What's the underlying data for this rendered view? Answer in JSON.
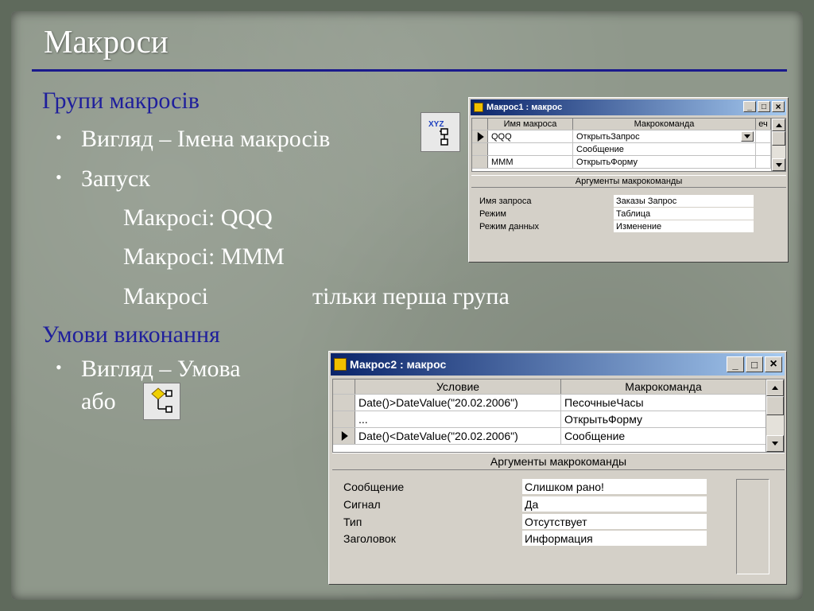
{
  "slide": {
    "title": "Макроси",
    "section1_heading": "Групи макросів",
    "bullet1": "Вигляд – Імена макросів",
    "bullet2": "Запуск",
    "sub1": "Макросі: QQQ",
    "sub2": "Макросі: MMM",
    "sub3_a": "Макросі",
    "sub3_b": "тільки перша група",
    "section2_heading": "Умови виконання",
    "bullet3_line1": "Вигляд – Умова",
    "bullet3_line2": "або"
  },
  "colors": {
    "heading": "#1f1f9c",
    "bullet_text": "#ffffff",
    "title_rule": "#1a1a8c",
    "titlebar_start": "#0a246a",
    "titlebar_end": "#a6caf0"
  },
  "icons": {
    "macro_names_toolbar_icon": "macro-names-icon",
    "conditions_toolbar_icon": "conditions-icon"
  },
  "window1": {
    "title": "Макрос1 : макрос",
    "controls": {
      "minimize": "_",
      "maximize": "□",
      "close": "×"
    },
    "columns": [
      "Имя макроса",
      "Макрокоманда",
      "еч"
    ],
    "rows": [
      {
        "name": "QQQ",
        "action": "ОткрытьЗапрос",
        "current": true
      },
      {
        "name": "",
        "action": "Сообщение",
        "current": false
      },
      {
        "name": "MMM",
        "action": "ОткрытьФорму",
        "current": false
      }
    ],
    "args_title": "Аргументы макрокоманды",
    "args": [
      {
        "label": "Имя запроса",
        "value": "Заказы Запрос"
      },
      {
        "label": "Режим",
        "value": "Таблица"
      },
      {
        "label": "Режим данных",
        "value": "Изменение"
      }
    ]
  },
  "window2": {
    "title": "Макрос2 : макрос",
    "controls": {
      "minimize": "_",
      "maximize": "□",
      "close": "×"
    },
    "columns": [
      "Условие",
      "Макрокоманда"
    ],
    "rows": [
      {
        "condition": "Date()>DateValue(\"20.02.2006\")",
        "action": "ПесочныеЧасы",
        "current": false
      },
      {
        "condition": "...",
        "action": "ОткрытьФорму",
        "current": false
      },
      {
        "condition": "Date()<DateValue(\"20.02.2006\")",
        "action": "Сообщение",
        "current": true
      }
    ],
    "args_title": "Аргументы макрокоманды",
    "args": [
      {
        "label": "Сообщение",
        "value": "Слишком рано!"
      },
      {
        "label": "Сигнал",
        "value": "Да"
      },
      {
        "label": "Тип",
        "value": "Отсутствует"
      },
      {
        "label": "Заголовок",
        "value": "Информация"
      }
    ]
  }
}
